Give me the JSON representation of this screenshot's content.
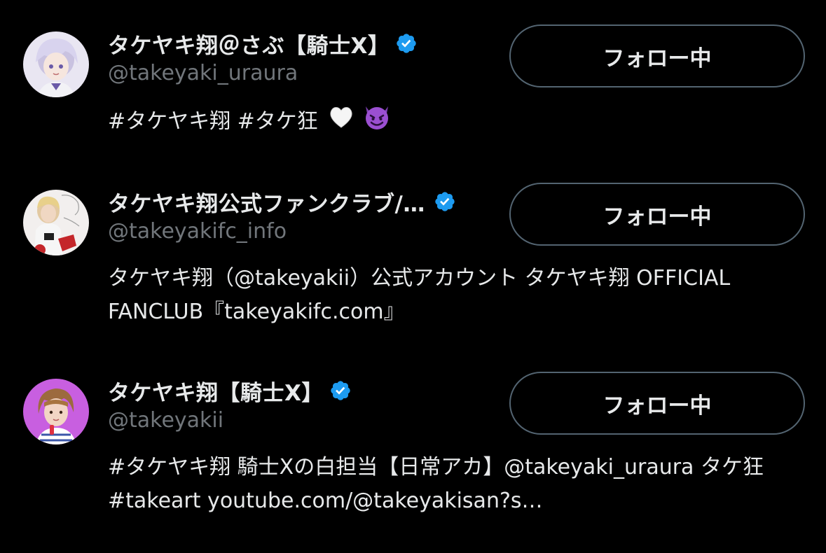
{
  "colors": {
    "background": "#000000",
    "primary_text": "#e7e9ea",
    "secondary_text": "#71767b",
    "verified_badge": "#1d9bf0",
    "button_border": "#536471"
  },
  "accounts": [
    {
      "display_name": "タケヤキ翔＠さぶ【騎士X】",
      "handle": "@takeyaki_uraura",
      "verified": true,
      "follow_label": "フォロー中",
      "bio": "#タケヤキ翔 #タケ狂",
      "bio_emoji": [
        "white-heart-icon",
        "smiling-devil-icon"
      ],
      "avatar_icon": "anime-avatar"
    },
    {
      "display_name": "タケヤキ翔公式ファンクラブ/…",
      "handle": "@takeyakifc_info",
      "verified": true,
      "follow_label": "フォロー中",
      "bio": "タケヤキ翔（@takeyakii）公式アカウント タケヤキ翔 OFFICIAL FANCLUB『takeyakifc.com』",
      "avatar_icon": "photo-avatar"
    },
    {
      "display_name": "タケヤキ翔【騎士X】",
      "handle": "@takeyakii",
      "verified": true,
      "follow_label": "フォロー中",
      "bio": "#タケヤキ翔 騎士Xの白担当【日常アカ】@takeyaki_uraura タケ狂 #takeart youtube.com/@takeyakisan?s…",
      "avatar_icon": "photo-avatar"
    }
  ]
}
